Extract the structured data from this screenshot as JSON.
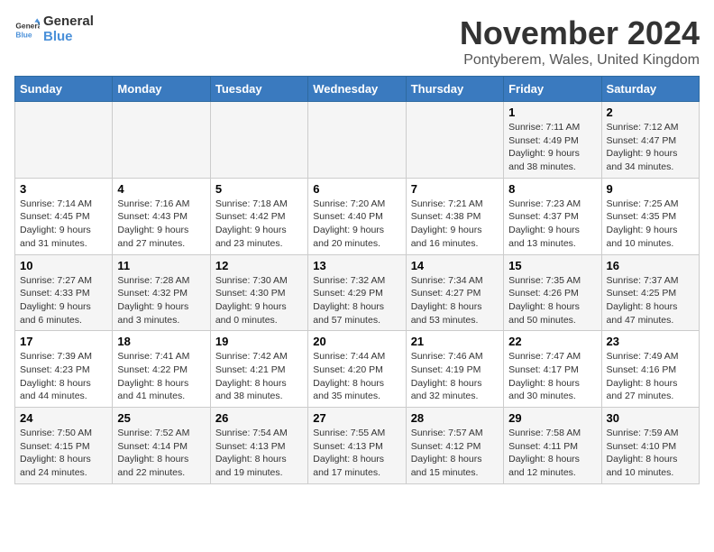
{
  "logo": {
    "text_general": "General",
    "text_blue": "Blue"
  },
  "header": {
    "title": "November 2024",
    "subtitle": "Pontyberem, Wales, United Kingdom"
  },
  "days_of_week": [
    "Sunday",
    "Monday",
    "Tuesday",
    "Wednesday",
    "Thursday",
    "Friday",
    "Saturday"
  ],
  "weeks": [
    {
      "days": [
        {
          "number": "",
          "info": ""
        },
        {
          "number": "",
          "info": ""
        },
        {
          "number": "",
          "info": ""
        },
        {
          "number": "",
          "info": ""
        },
        {
          "number": "",
          "info": ""
        },
        {
          "number": "1",
          "info": "Sunrise: 7:11 AM\nSunset: 4:49 PM\nDaylight: 9 hours and 38 minutes."
        },
        {
          "number": "2",
          "info": "Sunrise: 7:12 AM\nSunset: 4:47 PM\nDaylight: 9 hours and 34 minutes."
        }
      ]
    },
    {
      "days": [
        {
          "number": "3",
          "info": "Sunrise: 7:14 AM\nSunset: 4:45 PM\nDaylight: 9 hours and 31 minutes."
        },
        {
          "number": "4",
          "info": "Sunrise: 7:16 AM\nSunset: 4:43 PM\nDaylight: 9 hours and 27 minutes."
        },
        {
          "number": "5",
          "info": "Sunrise: 7:18 AM\nSunset: 4:42 PM\nDaylight: 9 hours and 23 minutes."
        },
        {
          "number": "6",
          "info": "Sunrise: 7:20 AM\nSunset: 4:40 PM\nDaylight: 9 hours and 20 minutes."
        },
        {
          "number": "7",
          "info": "Sunrise: 7:21 AM\nSunset: 4:38 PM\nDaylight: 9 hours and 16 minutes."
        },
        {
          "number": "8",
          "info": "Sunrise: 7:23 AM\nSunset: 4:37 PM\nDaylight: 9 hours and 13 minutes."
        },
        {
          "number": "9",
          "info": "Sunrise: 7:25 AM\nSunset: 4:35 PM\nDaylight: 9 hours and 10 minutes."
        }
      ]
    },
    {
      "days": [
        {
          "number": "10",
          "info": "Sunrise: 7:27 AM\nSunset: 4:33 PM\nDaylight: 9 hours and 6 minutes."
        },
        {
          "number": "11",
          "info": "Sunrise: 7:28 AM\nSunset: 4:32 PM\nDaylight: 9 hours and 3 minutes."
        },
        {
          "number": "12",
          "info": "Sunrise: 7:30 AM\nSunset: 4:30 PM\nDaylight: 9 hours and 0 minutes."
        },
        {
          "number": "13",
          "info": "Sunrise: 7:32 AM\nSunset: 4:29 PM\nDaylight: 8 hours and 57 minutes."
        },
        {
          "number": "14",
          "info": "Sunrise: 7:34 AM\nSunset: 4:27 PM\nDaylight: 8 hours and 53 minutes."
        },
        {
          "number": "15",
          "info": "Sunrise: 7:35 AM\nSunset: 4:26 PM\nDaylight: 8 hours and 50 minutes."
        },
        {
          "number": "16",
          "info": "Sunrise: 7:37 AM\nSunset: 4:25 PM\nDaylight: 8 hours and 47 minutes."
        }
      ]
    },
    {
      "days": [
        {
          "number": "17",
          "info": "Sunrise: 7:39 AM\nSunset: 4:23 PM\nDaylight: 8 hours and 44 minutes."
        },
        {
          "number": "18",
          "info": "Sunrise: 7:41 AM\nSunset: 4:22 PM\nDaylight: 8 hours and 41 minutes."
        },
        {
          "number": "19",
          "info": "Sunrise: 7:42 AM\nSunset: 4:21 PM\nDaylight: 8 hours and 38 minutes."
        },
        {
          "number": "20",
          "info": "Sunrise: 7:44 AM\nSunset: 4:20 PM\nDaylight: 8 hours and 35 minutes."
        },
        {
          "number": "21",
          "info": "Sunrise: 7:46 AM\nSunset: 4:19 PM\nDaylight: 8 hours and 32 minutes."
        },
        {
          "number": "22",
          "info": "Sunrise: 7:47 AM\nSunset: 4:17 PM\nDaylight: 8 hours and 30 minutes."
        },
        {
          "number": "23",
          "info": "Sunrise: 7:49 AM\nSunset: 4:16 PM\nDaylight: 8 hours and 27 minutes."
        }
      ]
    },
    {
      "days": [
        {
          "number": "24",
          "info": "Sunrise: 7:50 AM\nSunset: 4:15 PM\nDaylight: 8 hours and 24 minutes."
        },
        {
          "number": "25",
          "info": "Sunrise: 7:52 AM\nSunset: 4:14 PM\nDaylight: 8 hours and 22 minutes."
        },
        {
          "number": "26",
          "info": "Sunrise: 7:54 AM\nSunset: 4:13 PM\nDaylight: 8 hours and 19 minutes."
        },
        {
          "number": "27",
          "info": "Sunrise: 7:55 AM\nSunset: 4:13 PM\nDaylight: 8 hours and 17 minutes."
        },
        {
          "number": "28",
          "info": "Sunrise: 7:57 AM\nSunset: 4:12 PM\nDaylight: 8 hours and 15 minutes."
        },
        {
          "number": "29",
          "info": "Sunrise: 7:58 AM\nSunset: 4:11 PM\nDaylight: 8 hours and 12 minutes."
        },
        {
          "number": "30",
          "info": "Sunrise: 7:59 AM\nSunset: 4:10 PM\nDaylight: 8 hours and 10 minutes."
        }
      ]
    }
  ]
}
